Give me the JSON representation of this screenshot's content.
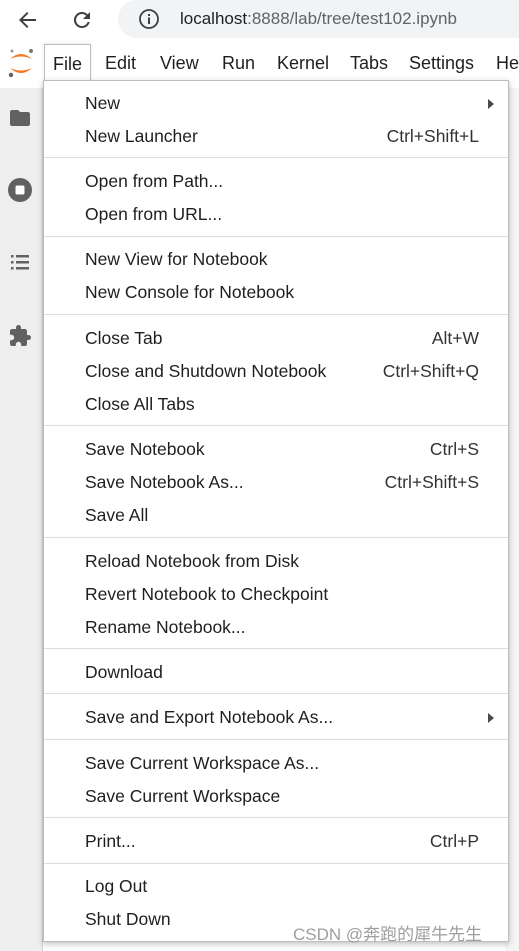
{
  "browser": {
    "url_host": "localhost",
    "url_rest": ":8888/lab/tree/test102.ipynb"
  },
  "menubar": {
    "items": [
      "File",
      "Edit",
      "View",
      "Run",
      "Kernel",
      "Tabs",
      "Settings",
      "He"
    ]
  },
  "file_menu": {
    "new": "New",
    "new_launcher": "New Launcher",
    "new_launcher_shortcut": "Ctrl+Shift+L",
    "open_from_path": "Open from Path...",
    "open_from_url": "Open from URL...",
    "new_view": "New View for Notebook",
    "new_console": "New Console for Notebook",
    "close_tab": "Close Tab",
    "close_tab_shortcut": "Alt+W",
    "close_shutdown": "Close and Shutdown Notebook",
    "close_shutdown_shortcut": "Ctrl+Shift+Q",
    "close_all": "Close All Tabs",
    "save_notebook": "Save Notebook",
    "save_notebook_shortcut": "Ctrl+S",
    "save_notebook_as": "Save Notebook As...",
    "save_notebook_as_shortcut": "Ctrl+Shift+S",
    "save_all": "Save All",
    "reload": "Reload Notebook from Disk",
    "revert": "Revert Notebook to Checkpoint",
    "rename": "Rename Notebook...",
    "download": "Download",
    "save_export": "Save and Export Notebook As...",
    "save_workspace_as": "Save Current Workspace As...",
    "save_workspace": "Save Current Workspace",
    "print": "Print...",
    "print_shortcut": "Ctrl+P",
    "log_out": "Log Out",
    "shut_down": "Shut Down"
  },
  "watermark": "CSDN @奔跑的犀牛先生",
  "colors": {
    "jupyter_orange": "#f37726",
    "icon_dark": "#616161"
  },
  "icons": [
    "back-arrow-icon",
    "reload-icon",
    "info-icon",
    "jupyter-logo",
    "folder-icon",
    "stop-circle-icon",
    "list-icon",
    "puzzle-icon",
    "submenu-arrow-icon"
  ]
}
